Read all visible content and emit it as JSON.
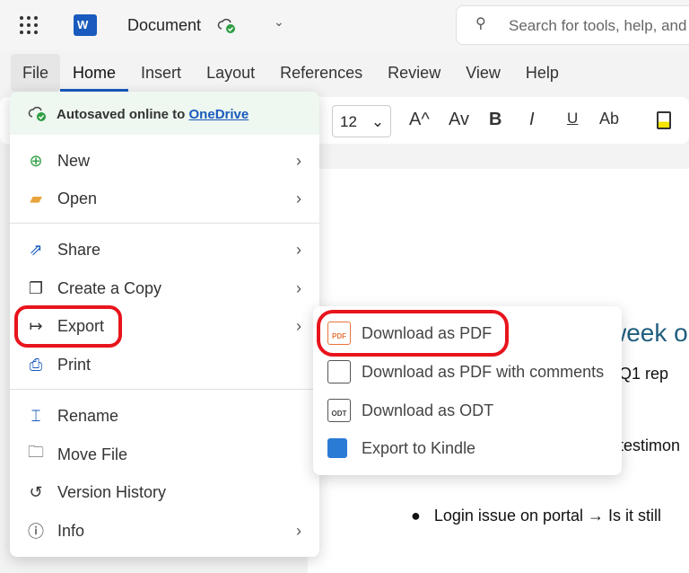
{
  "header": {
    "doc_title": "Document",
    "search_placeholder": "Search for tools, help, and more",
    "app_logo": "W"
  },
  "tabs": [
    "File",
    "Home",
    "Insert",
    "Layout",
    "References",
    "Review",
    "View",
    "Help"
  ],
  "ribbon": {
    "font_size": "12",
    "buttons": [
      "A^",
      "Av",
      "B",
      "I",
      "U",
      "Ab"
    ]
  },
  "file_menu": {
    "autosave_text": "Autosaved online to",
    "autosave_link": "OneDrive",
    "items": [
      {
        "label": "New",
        "icon": "plus-circle-icon",
        "submenu": true
      },
      {
        "label": "Open",
        "icon": "folder-icon",
        "submenu": true
      },
      {
        "label": "Share",
        "icon": "share-icon",
        "submenu": true
      },
      {
        "label": "Create a Copy",
        "icon": "copy-icon",
        "submenu": true
      },
      {
        "label": "Export",
        "icon": "export-icon",
        "submenu": true
      },
      {
        "label": "Print",
        "icon": "printer-icon",
        "submenu": false
      },
      {
        "label": "Rename",
        "icon": "rename-icon",
        "submenu": false
      },
      {
        "label": "Move File",
        "icon": "move-folder-icon",
        "submenu": false
      },
      {
        "label": "Version History",
        "icon": "history-icon",
        "submenu": false
      },
      {
        "label": "Info",
        "icon": "info-icon",
        "submenu": true
      }
    ]
  },
  "export_menu": {
    "items": [
      {
        "label": "Download as PDF",
        "icon_text": "PDF"
      },
      {
        "label": "Download as PDF with comments",
        "icon_text": ""
      },
      {
        "label": "Download as ODT",
        "icon_text": "ODT"
      },
      {
        "label": "Export to Kindle",
        "icon_text": ""
      }
    ]
  },
  "document": {
    "heading_fragment": "week o",
    "line1": ": Q1 rep",
    "line2": "t testimon",
    "bullet": "Login issue on portal → Is it still"
  },
  "colors": {
    "accent": "#185abd",
    "highlight": "#e8141c",
    "heading": "#1f5e7e"
  }
}
